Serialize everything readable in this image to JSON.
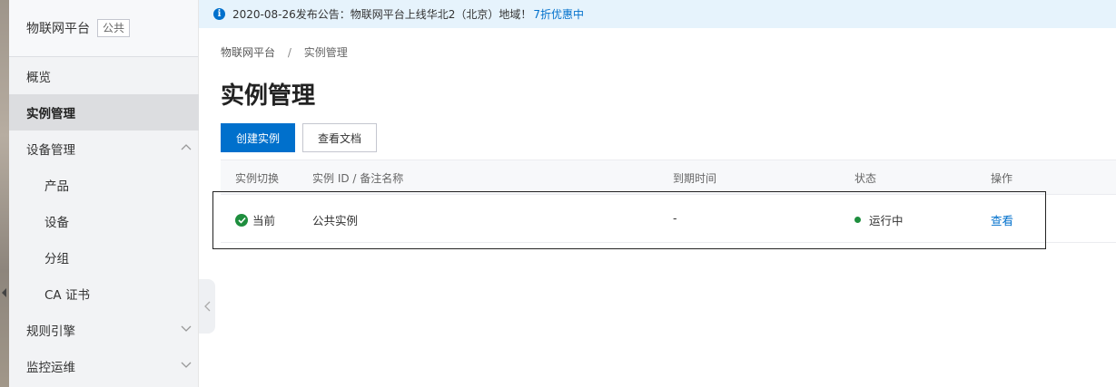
{
  "sidebar": {
    "title": "物联网平台",
    "badge": "公共",
    "items": [
      {
        "label": "概览"
      },
      {
        "label": "实例管理"
      },
      {
        "label": "设备管理"
      },
      {
        "label": "产品"
      },
      {
        "label": "设备"
      },
      {
        "label": "分组"
      },
      {
        "label": "CA 证书"
      },
      {
        "label": "规则引擎"
      },
      {
        "label": "监控运维"
      }
    ]
  },
  "notice": {
    "text": "2020-08-26发布公告：物联网平台上线华北2（北京）地域！",
    "link": "7折优惠中"
  },
  "breadcrumb": {
    "root": "物联网平台",
    "separator": "/",
    "current": "实例管理"
  },
  "page_title": "实例管理",
  "buttons": {
    "create": "创建实例",
    "docs": "查看文档"
  },
  "table": {
    "headers": [
      "实例切换",
      "实例 ID / 备注名称",
      "到期时间",
      "状态",
      "操作"
    ],
    "rows": [
      {
        "switch": "当前",
        "name": "公共实例",
        "expire": "-",
        "status": "运行中",
        "action": "查看"
      }
    ]
  },
  "colors": {
    "accent": "#0070cc",
    "success": "#1e8e3e",
    "notice_bg": "#e6f3fc"
  }
}
